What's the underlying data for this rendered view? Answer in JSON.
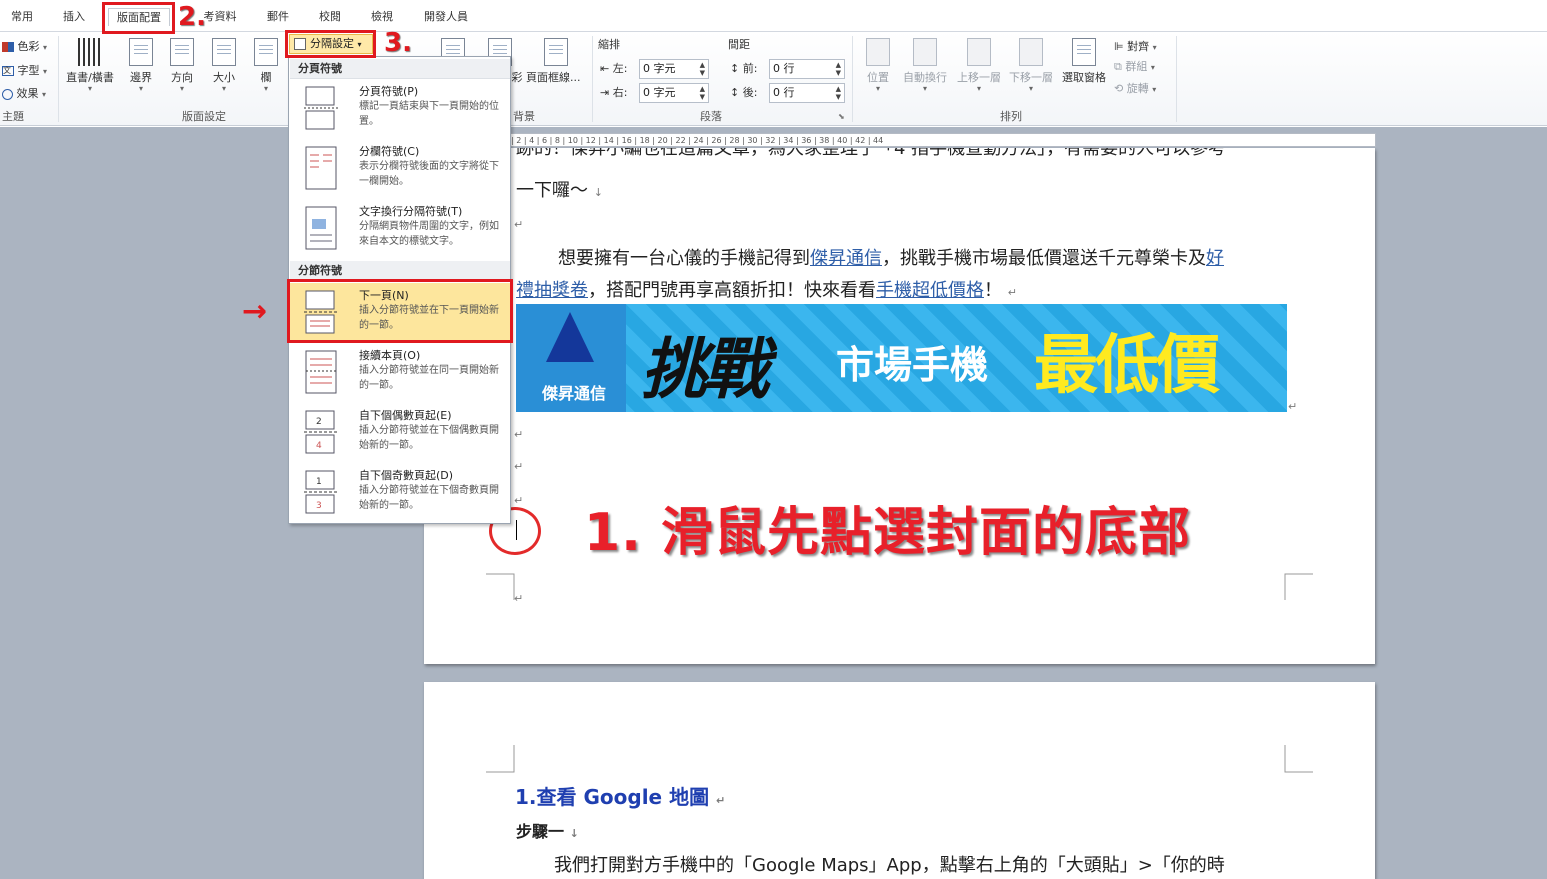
{
  "ribbon": {
    "tabs": [
      "常用",
      "插入",
      "版面配置",
      "考資料",
      "郵件",
      "校閱",
      "檢視",
      "開發人員"
    ],
    "active_tab": "版面配置",
    "theme_group": {
      "label": "主題",
      "items": [
        "色彩",
        "字型",
        "效果"
      ]
    },
    "page_setup_group": {
      "label": "版面設定",
      "commands": [
        "直書/橫書",
        "邊界",
        "方向",
        "大小",
        "欄"
      ],
      "break_button": "分隔設定"
    },
    "page_bg_group": {
      "label": "背景",
      "commands": [
        "彩",
        "頁面框線..."
      ]
    },
    "paragraph_group": {
      "label": "段落",
      "indent_title": "縮排",
      "spacing_title": "間距",
      "indent_left_label": "左:",
      "indent_left_value": "0 字元",
      "indent_right_label": "右:",
      "indent_right_value": "0 字元",
      "spacing_before_label": "前:",
      "spacing_before_value": "0 行",
      "spacing_after_label": "後:",
      "spacing_after_value": "0 行"
    },
    "arrange_group": {
      "label": "排列",
      "commands": [
        "位置",
        "自動換行",
        "上移一層",
        "下移一層",
        "選取窗格"
      ],
      "small": [
        "對齊",
        "群組",
        "旋轉"
      ]
    }
  },
  "break_menu": {
    "page_breaks_header": "分頁符號",
    "section_breaks_header": "分節符號",
    "items": [
      {
        "title": "分頁符號(P)",
        "desc": "標記一頁結束與下一頁開始的位置。"
      },
      {
        "title": "分欄符號(C)",
        "desc": "表示分欄符號後面的文字將從下一欄開始。"
      },
      {
        "title": "文字換行分隔符號(T)",
        "desc": "分隔網頁物件周圍的文字，例如來自本文的標號文字。"
      },
      {
        "title": "下一頁(N)",
        "desc": "插入分節符號並在下一頁開始新的一節。"
      },
      {
        "title": "接續本頁(O)",
        "desc": "插入分節符號並在同一頁開始新的一節。"
      },
      {
        "title": "自下個偶數頁起(E)",
        "desc": "插入分節符號並在下個偶數頁開始新的一節。"
      },
      {
        "title": "自下個奇數頁起(D)",
        "desc": "插入分節符號並在下個奇數頁開始新的一節。"
      }
    ]
  },
  "annotations": {
    "step1": "1. 滑鼠先點選封面的底部",
    "step2": "2.",
    "step3": "3.",
    "arrow": "→"
  },
  "document": {
    "ruler_text": "| 2 | 4 | 6 | 8 | 10 | 12 | 14 | 16 | 18 | 20 | 22 | 24 | 26 | 28 | 30 | 32 | 34 | 36 | 38 | 40 | 42 | 44",
    "page1": {
      "line_top": "跡的！傑昇小編也在這篇文章，為大家整理了「4 指手機查勤方法」，有需要的人可以參考",
      "line_2": "一下囉～",
      "para_a": "想要擁有一台心儀的手機記得到",
      "link_1": "傑昇通信",
      "para_b": "，挑戰手機市場最低價還送千元尊榮卡及",
      "link_2a": "好",
      "link_2b": "禮抽獎卷",
      "para_c": "，搭配門號再享高額折扣！快來看看",
      "link_3": "手機超低價格",
      "para_d": "！",
      "banner_logo": "傑昇通信",
      "banner_t1": "挑戰",
      "banner_t2": "市場手機",
      "banner_t3": "最低價",
      "para_mark": "↵",
      "line_mark": "↓"
    },
    "page2": {
      "heading_num": "1.",
      "heading": "查看 Google 地圖",
      "step": "步驟一",
      "body": "我們打開對方手機中的「Google Maps」App，點擊右上角的「大頭貼」>「你的時"
    }
  }
}
